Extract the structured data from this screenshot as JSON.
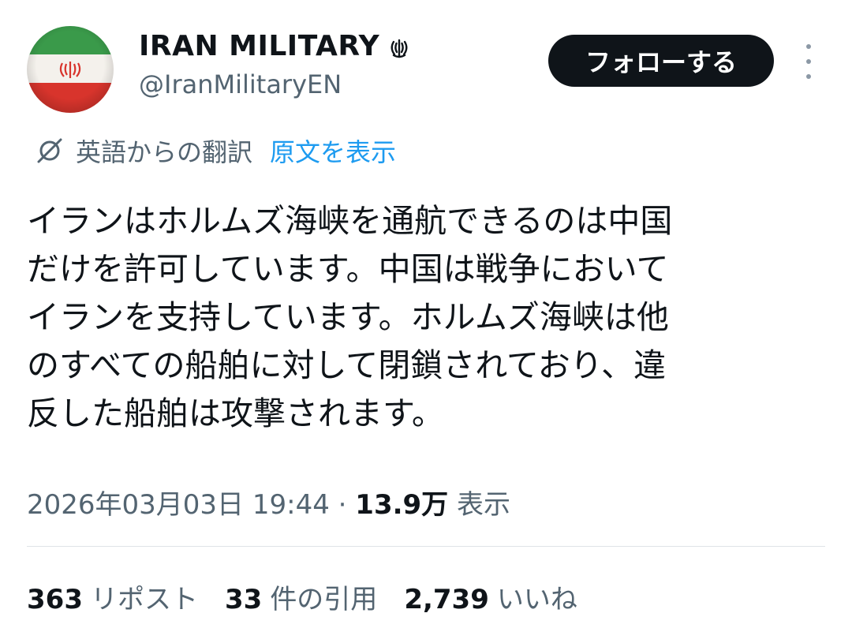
{
  "author": {
    "display_name": "IRAN MILITARY",
    "handle": "@IranMilitaryEN",
    "avatar_icon": "iran-flag-icon",
    "badge_icon": "iran-emblem-icon"
  },
  "actions": {
    "follow_label": "フォローする",
    "more_icon": "more-dots-icon"
  },
  "translation": {
    "label": "英語からの翻訳",
    "show_original": "原文を表示",
    "icon": "translate-icon"
  },
  "tweet": {
    "text": "イランはホルムズ海峡を通航できるのは中国\nだけを許可しています。中国は戦争において\nイランを支持しています。ホルムズ海峡は他\nのすべての船舶に対して閉鎖されており、違\n反した船舶は攻撃されます。"
  },
  "meta": {
    "timestamp": "2026年03月03日 19:44",
    "separator": "·",
    "views_count": "13.9万",
    "views_label": "表示"
  },
  "stats": [
    {
      "count": "363",
      "label": "リポスト"
    },
    {
      "count": "33",
      "label": "件の引用"
    },
    {
      "count": "2,739",
      "label": "いいね"
    }
  ],
  "colors": {
    "text": "#0f1419",
    "secondary": "#536471",
    "link": "#1d9bf0",
    "button_bg": "#0f1419",
    "divider": "#dfe3e7"
  }
}
